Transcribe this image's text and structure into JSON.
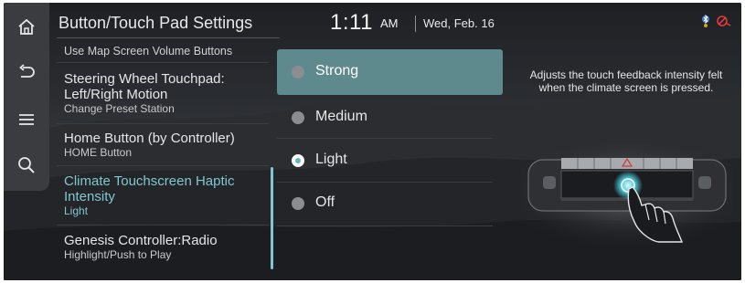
{
  "header": {
    "title": "Button/Touch Pad Settings",
    "time": "1:11",
    "ampm": "AM",
    "date": "Wed, Feb. 16"
  },
  "rail": {
    "items": [
      {
        "icon": "home-icon"
      },
      {
        "icon": "back-icon"
      },
      {
        "icon": "menu-icon"
      },
      {
        "icon": "search-icon"
      }
    ]
  },
  "status_icons": [
    "bluetooth-icon",
    "phone-disconnected-icon"
  ],
  "menu": {
    "items": [
      {
        "title": "Use Map Screen Volume Buttons",
        "subtitle": ""
      },
      {
        "title": "Steering Wheel Touchpad:",
        "title2": "Left/Right Motion",
        "subtitle": "Change Preset Station"
      },
      {
        "title": "Home Button (by Controller)",
        "subtitle": "HOME Button"
      },
      {
        "title": "Climate Touchscreen Haptic",
        "title2": "Intensity",
        "subtitle": "Light",
        "selected": true
      },
      {
        "title": "Genesis Controller:Radio",
        "subtitle": "Highlight/Push to Play"
      }
    ]
  },
  "options": [
    {
      "label": "Strong",
      "highlighted": true,
      "checked": false
    },
    {
      "label": "Medium",
      "highlighted": false,
      "checked": false
    },
    {
      "label": "Light",
      "highlighted": false,
      "checked": true
    },
    {
      "label": "Off",
      "highlighted": false,
      "checked": false
    }
  ],
  "description": "Adjusts the touch feedback intensity felt when the climate screen is pressed.",
  "colors": {
    "accent": "#7fc7cf",
    "highlight": "#5e8a8e",
    "background": "#202226"
  }
}
